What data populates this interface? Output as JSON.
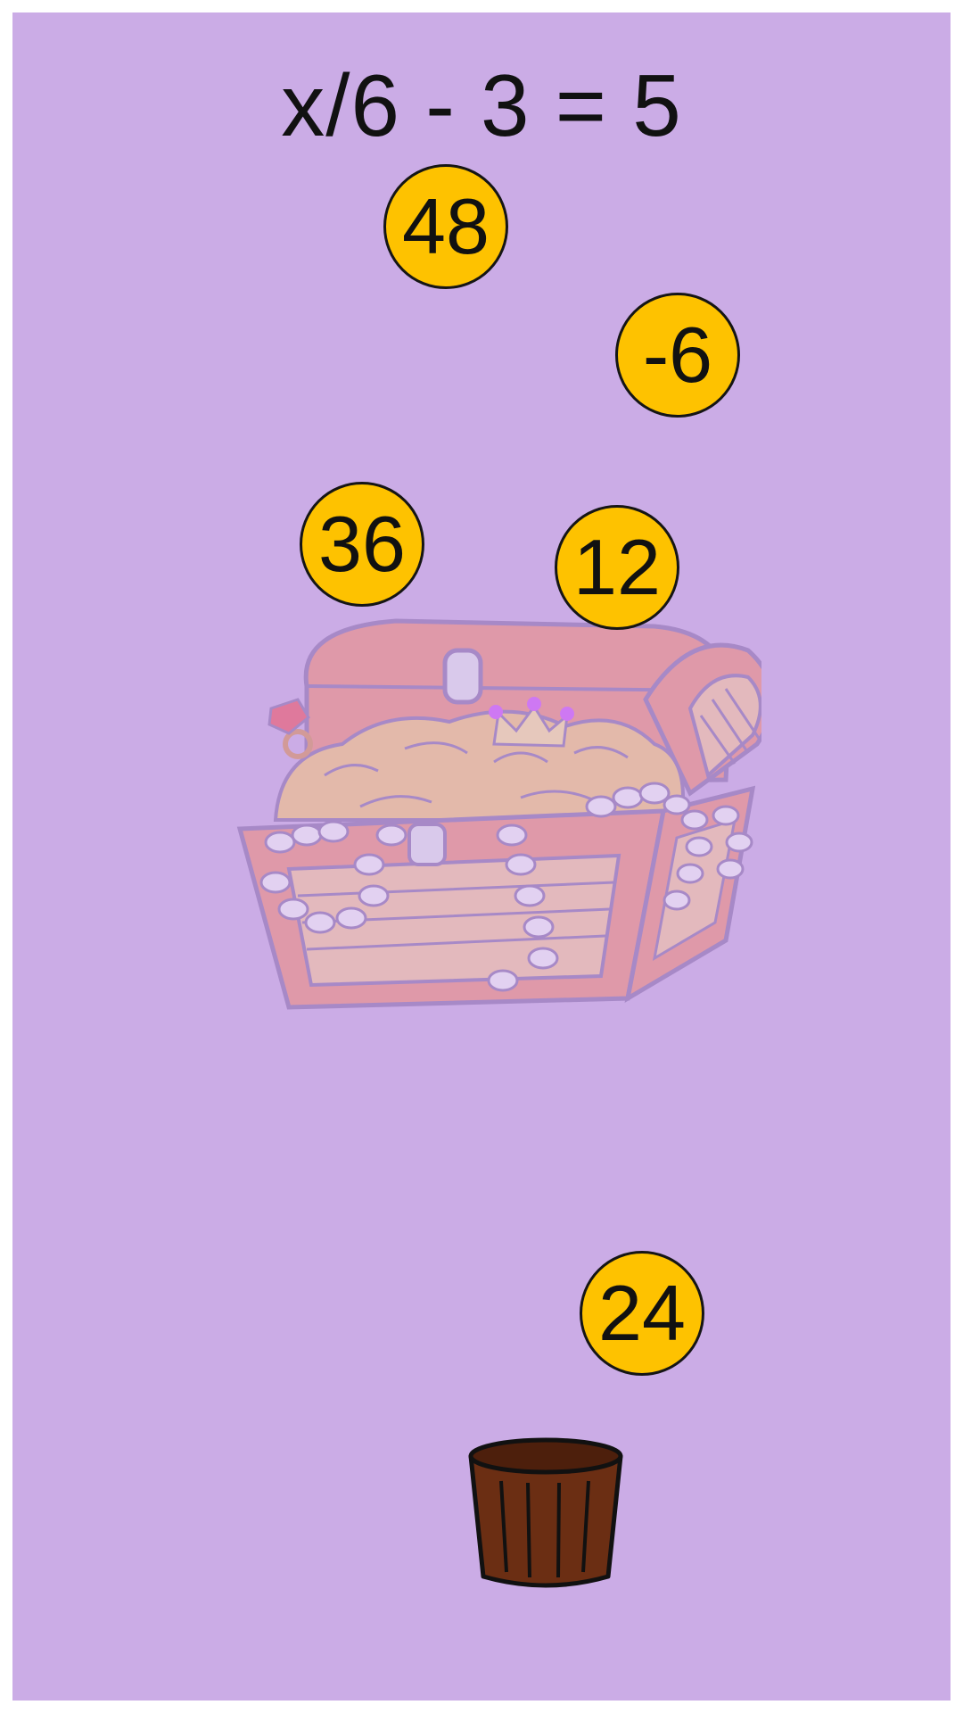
{
  "equation": "x/6 - 3 = 5",
  "coins": [
    {
      "id": "48",
      "label": "48"
    },
    {
      "id": "neg6",
      "label": "-6"
    },
    {
      "id": "36",
      "label": "36"
    },
    {
      "id": "12",
      "label": "12"
    },
    {
      "id": "24",
      "label": "24"
    }
  ],
  "icons": {
    "chest": "treasure-chest-icon",
    "bucket": "bucket-icon"
  },
  "colors": {
    "background": "#cbace6",
    "coin": "#fec200",
    "bucket": "#6b2e13"
  }
}
